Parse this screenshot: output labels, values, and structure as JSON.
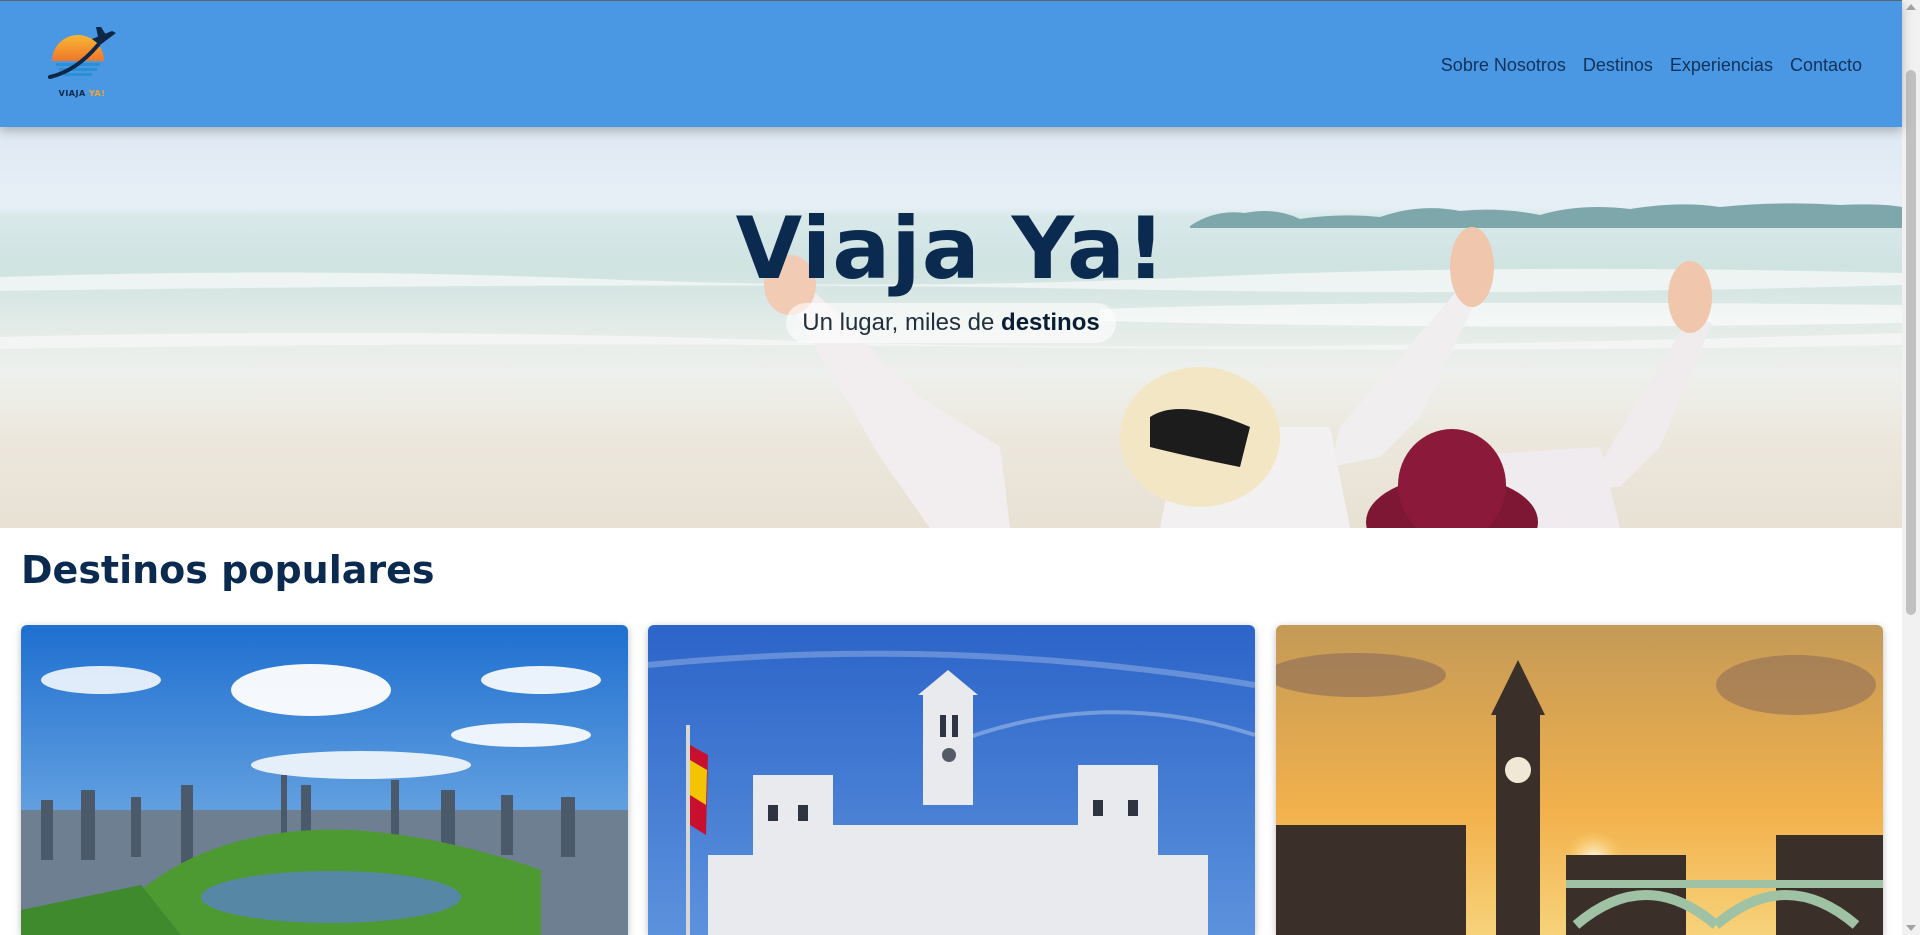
{
  "header": {
    "logo_text_main": "VIAJA",
    "logo_text_accent": "YA!",
    "nav": [
      "Sobre Nosotros",
      "Destinos",
      "Experiencias",
      "Contacto"
    ]
  },
  "hero": {
    "title": "Viaja Ya!",
    "subtitle_prefix": "Un lugar, miles de",
    "subtitle_bold": "destinos"
  },
  "section": {
    "title": "Destinos populares"
  },
  "cards": [
    {
      "image": "new-york-central-park-photo"
    },
    {
      "image": "madrid-cibeles-palace-photo"
    },
    {
      "image": "london-big-ben-photo"
    }
  ],
  "colors": {
    "header_bg": "#4a97e3",
    "nav_text": "#11325a",
    "title_text": "#0b2a4f"
  }
}
